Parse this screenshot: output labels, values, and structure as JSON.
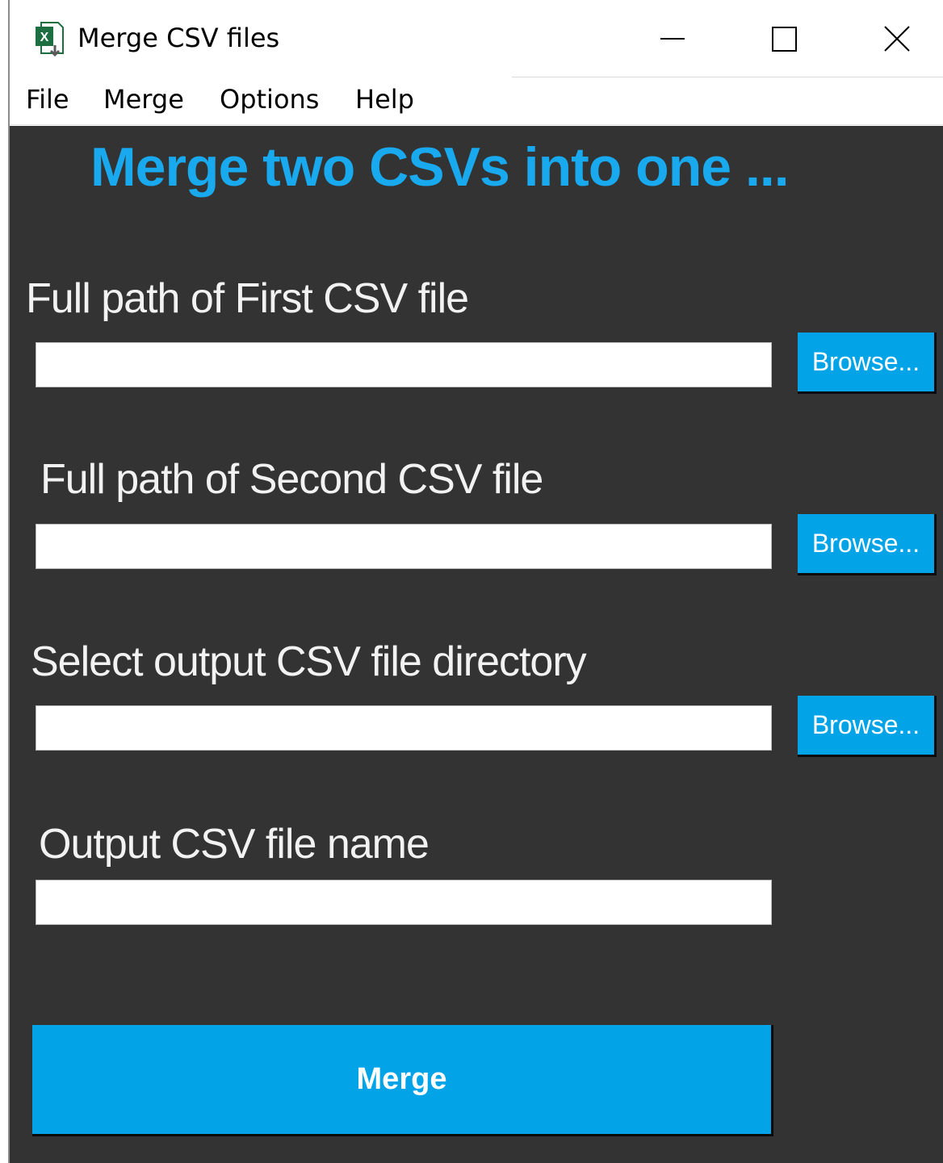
{
  "window": {
    "title": "Merge CSV files",
    "icon": "excel-file-icon"
  },
  "menu": [
    {
      "label": "File"
    },
    {
      "label": "Merge"
    },
    {
      "label": "Options"
    },
    {
      "label": "Help"
    }
  ],
  "main": {
    "headline": "Merge two CSVs into one ...",
    "first_csv": {
      "label": "Full path of First CSV file",
      "value": "",
      "browse_label": "Browse..."
    },
    "second_csv": {
      "label": "Full path of Second CSV file",
      "value": "",
      "browse_label": "Browse..."
    },
    "output_dir": {
      "label": "Select output CSV file directory",
      "value": "",
      "browse_label": "Browse..."
    },
    "output_name": {
      "label": "Output CSV file name",
      "value": ""
    },
    "merge_label": "Merge"
  },
  "colors": {
    "accent": "#03a3e8",
    "headline": "#18a9ee",
    "background": "#333333",
    "label_text": "#f2f2f2"
  }
}
